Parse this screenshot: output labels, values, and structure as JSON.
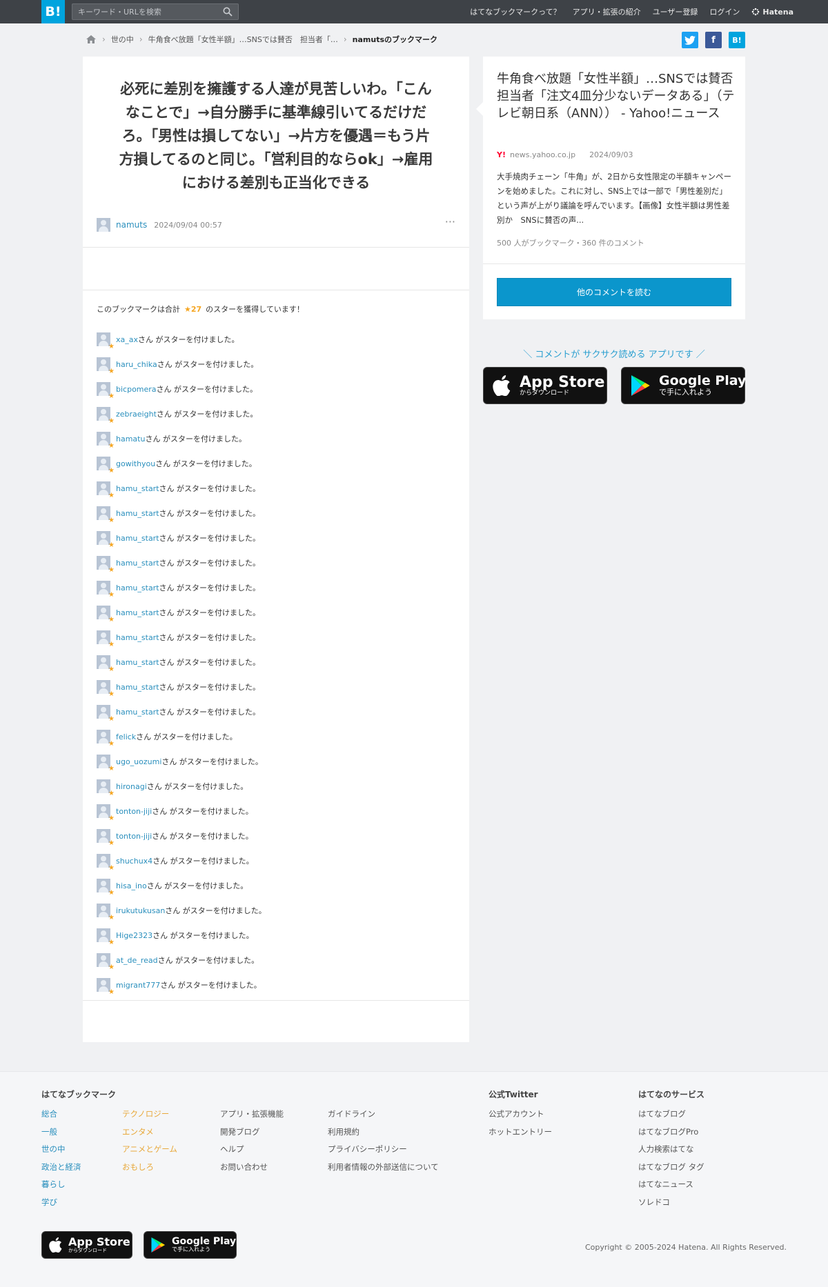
{
  "header": {
    "logo": "B!",
    "search_placeholder": "キーワード・URLを検索",
    "nav": [
      "はてなブックマークって？",
      "アプリ・拡張の紹介",
      "ユーザー登録",
      "ログイン"
    ],
    "brand": "Hatena"
  },
  "breadcrumb": {
    "items": [
      "世の中",
      "牛角食べ放題「女性半額」…SNSでは賛否　担当者「…"
    ],
    "current": "namutsのブックマーク"
  },
  "share": {
    "twitter": "t",
    "facebook": "f",
    "hatebu": "B!"
  },
  "comment": {
    "lines": [
      "必死に差別を擁護する人達が見苦しいわ。「こん",
      "なことで」→自分勝手に基準線引いてるだけだ",
      "ろ。「男性は損してない」→片方を優遇＝もう片",
      "方損してるのと同じ。「営利目的ならok」→雇用",
      "における差別も正当化できる"
    ],
    "user": "namuts",
    "time": "2024/09/04 00:57",
    "more": "···"
  },
  "stars": {
    "prefix": "このブックマークは合計",
    "count": "★27",
    "suffix": "のスターを獲得しています！",
    "row_suffix": "さん がスターを付けました。",
    "users": [
      "xa_ax",
      "haru_chika",
      "bicpomera",
      "zebraeight",
      "hamatu",
      "gowithyou",
      "hamu_start",
      "hamu_start",
      "hamu_start",
      "hamu_start",
      "hamu_start",
      "hamu_start",
      "hamu_start",
      "hamu_start",
      "hamu_start",
      "hamu_start",
      "felick",
      "ugo_uozumi",
      "hironagi",
      "tonton-jiji",
      "tonton-jiji",
      "shuchux4",
      "hisa_ino",
      "irukutukusan",
      "Hige2323",
      "at_de_read",
      "migrant777"
    ]
  },
  "entry": {
    "title": "牛角食べ放題「女性半額」…SNSでは賛否　担当者「注文4皿分少ないデータある」（テレビ朝日系（ANN）） - Yahoo!ニュース",
    "site_icon": "Y!",
    "domain": "news.yahoo.co.jp",
    "date": "2024/09/03",
    "description": "大手焼肉チェーン「牛角」が、2日から女性限定の半額キャンペーンを始めました。これに対し、SNS上では一部で「男性差別だ」という声が上がり議論を呼んでいます。【画像】女性半額は男性差別か　SNSに賛否の声...",
    "count": "500 人がブックマーク・360 件のコメント",
    "read_button": "他のコメントを読む"
  },
  "app_promo": "＼ コメントが サクサク読める アプリです ／",
  "stores": {
    "apple_big": "App Store",
    "apple_small": "からダウンロード",
    "google_big": "Google Play",
    "google_small": "で手に入れよう"
  },
  "footer": {
    "head_bookmark": "はてなブックマーク",
    "cat_col1": [
      "総合",
      "一般",
      "世の中",
      "政治と経済",
      "暮らし",
      "学び"
    ],
    "cat_col2": [
      "テクノロジー",
      "エンタメ",
      "アニメとゲーム",
      "おもしろ"
    ],
    "links_col3": [
      "アプリ・拡張機能",
      "開発ブログ",
      "ヘルプ",
      "お問い合わせ"
    ],
    "links_col4": [
      "ガイドライン",
      "利用規約",
      "プライバシーポリシー",
      "利用者情報の外部送信について"
    ],
    "head_twitter": "公式Twitter",
    "twitter_links": [
      "公式アカウント",
      "ホットエントリー"
    ],
    "head_services": "はてなのサービス",
    "services": [
      "はてなブログ",
      "はてなブログPro",
      "人力検索はてな",
      "はてなブログ タグ",
      "はてなニュース",
      "ソレドコ"
    ],
    "copyright": "Copyright © 2005-2024 Hatena. All Rights Reserved."
  },
  "colors": {
    "accent": "#00a4de",
    "link": "#2a8fbd",
    "star": "#f5a623",
    "button": "#0b96cc"
  }
}
